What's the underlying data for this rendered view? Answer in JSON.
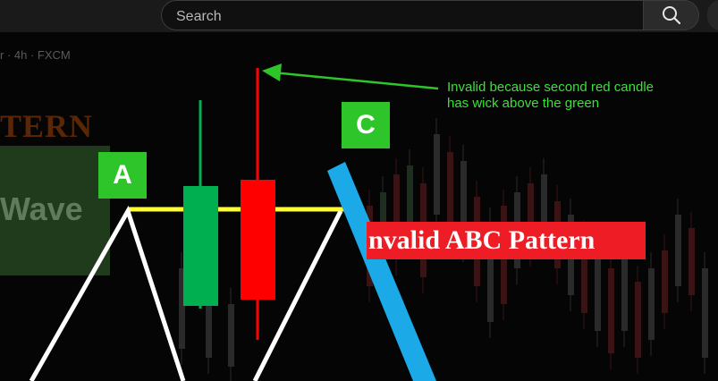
{
  "header": {
    "search_placeholder": "Search",
    "search_icon": "magnifier-icon",
    "mic_icon": "microphone-icon"
  },
  "video": {
    "symbol_info": "r · 4h · FXCM",
    "faded_title": "TERN",
    "faded_wave": "Wave",
    "label_a": "A",
    "label_c": "C",
    "banner": "nvalid ABC Pattern",
    "annotation_line1": "Invalid because second red candle",
    "annotation_line2": "has wick above the green",
    "colors": {
      "green_candle": "#00b050",
      "red_candle": "#ff0000",
      "yellow_line": "#ffff33",
      "label_green": "#2ec52b",
      "banner_red": "#ee1c25",
      "arrow_blue": "#1ba9e8",
      "annotation_green": "#3ddf3a"
    }
  }
}
